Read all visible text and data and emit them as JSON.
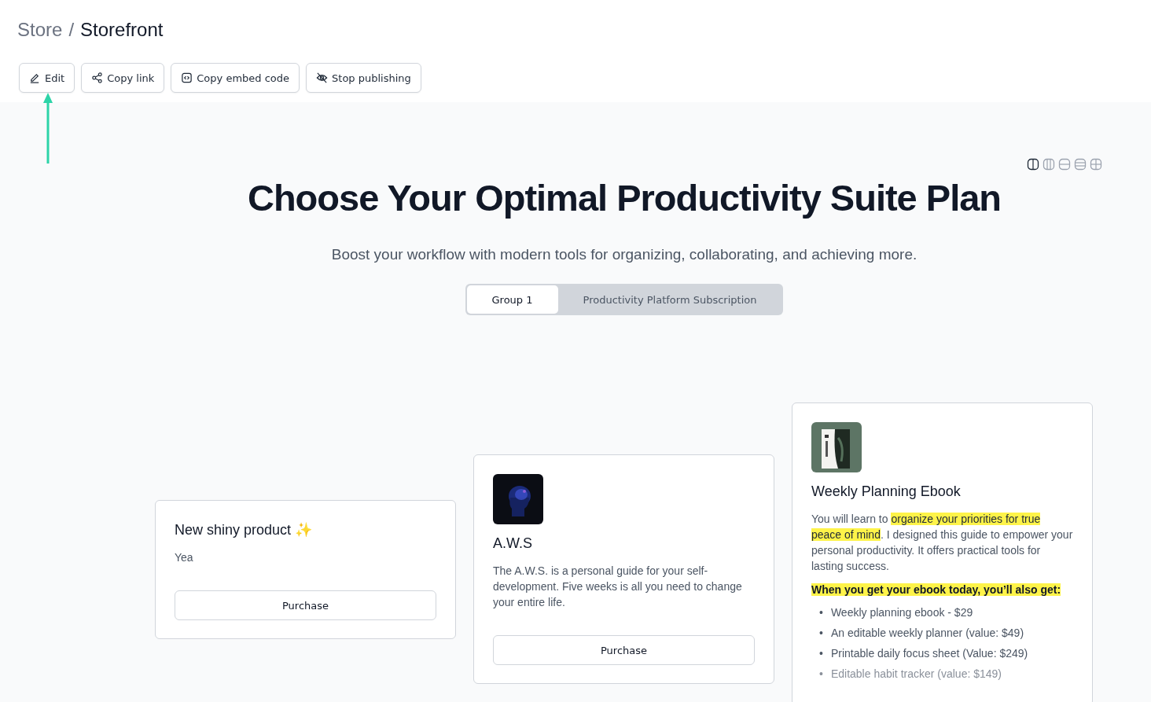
{
  "breadcrumb": {
    "parent": "Store",
    "separator": "/",
    "current": "Storefront"
  },
  "toolbar": [
    {
      "kind": "edit",
      "label": "Edit"
    },
    {
      "kind": "share",
      "label": "Copy link"
    },
    {
      "kind": "embed",
      "label": "Copy embed code"
    },
    {
      "kind": "unpublish",
      "label": "Stop publishing"
    }
  ],
  "layout_options": [
    {
      "kind": "columns2",
      "selected": true
    },
    {
      "kind": "columns3",
      "selected": false
    },
    {
      "kind": "rows2",
      "selected": false
    },
    {
      "kind": "rows3",
      "selected": false
    },
    {
      "kind": "grid",
      "selected": false
    }
  ],
  "title": "Choose Your Optimal Productivity Suite Plan",
  "subtitle": "Boost your workflow with modern tools for organizing, collaborating, and achieving more.",
  "groups": [
    {
      "label": "Group 1",
      "selected": true
    },
    {
      "label": "Productivity Platform Subscription",
      "selected": false
    }
  ],
  "products": [
    {
      "name": "New shiny product ✨",
      "image": false,
      "description": [
        {
          "text": "Yea",
          "highlighted": false
        }
      ],
      "button": "Purchase"
    },
    {
      "name": "A.W.S",
      "image": true,
      "description": [
        {
          "text": "The A.W.S. is a personal guide for your self-development. Five weeks is all you need to change your entire life.",
          "highlighted": false
        }
      ],
      "button": "Purchase"
    },
    {
      "name": "Weekly Planning Ebook",
      "image": true,
      "description": [
        {
          "text": "You will learn to ",
          "highlighted": false
        },
        {
          "text": "organize your priorities for true peace of mind",
          "highlighted": true
        },
        {
          "text": ". I designed this guide to empower your personal productivity. It offers practical tools for lasting success.",
          "highlighted": false
        }
      ],
      "bonus_heading": "When you get your ebook today, you’ll also get:",
      "bonus_items": [
        {
          "marker": "•",
          "text": "Weekly planning ebook - $29"
        },
        {
          "marker": "•",
          "text": "An editable weekly planner (value: $49)"
        },
        {
          "marker": "•",
          "text": "Printable daily focus sheet (Value: $249)"
        },
        {
          "marker": "•",
          "text": "Editable habit tracker (value: $149)"
        }
      ]
    }
  ]
}
